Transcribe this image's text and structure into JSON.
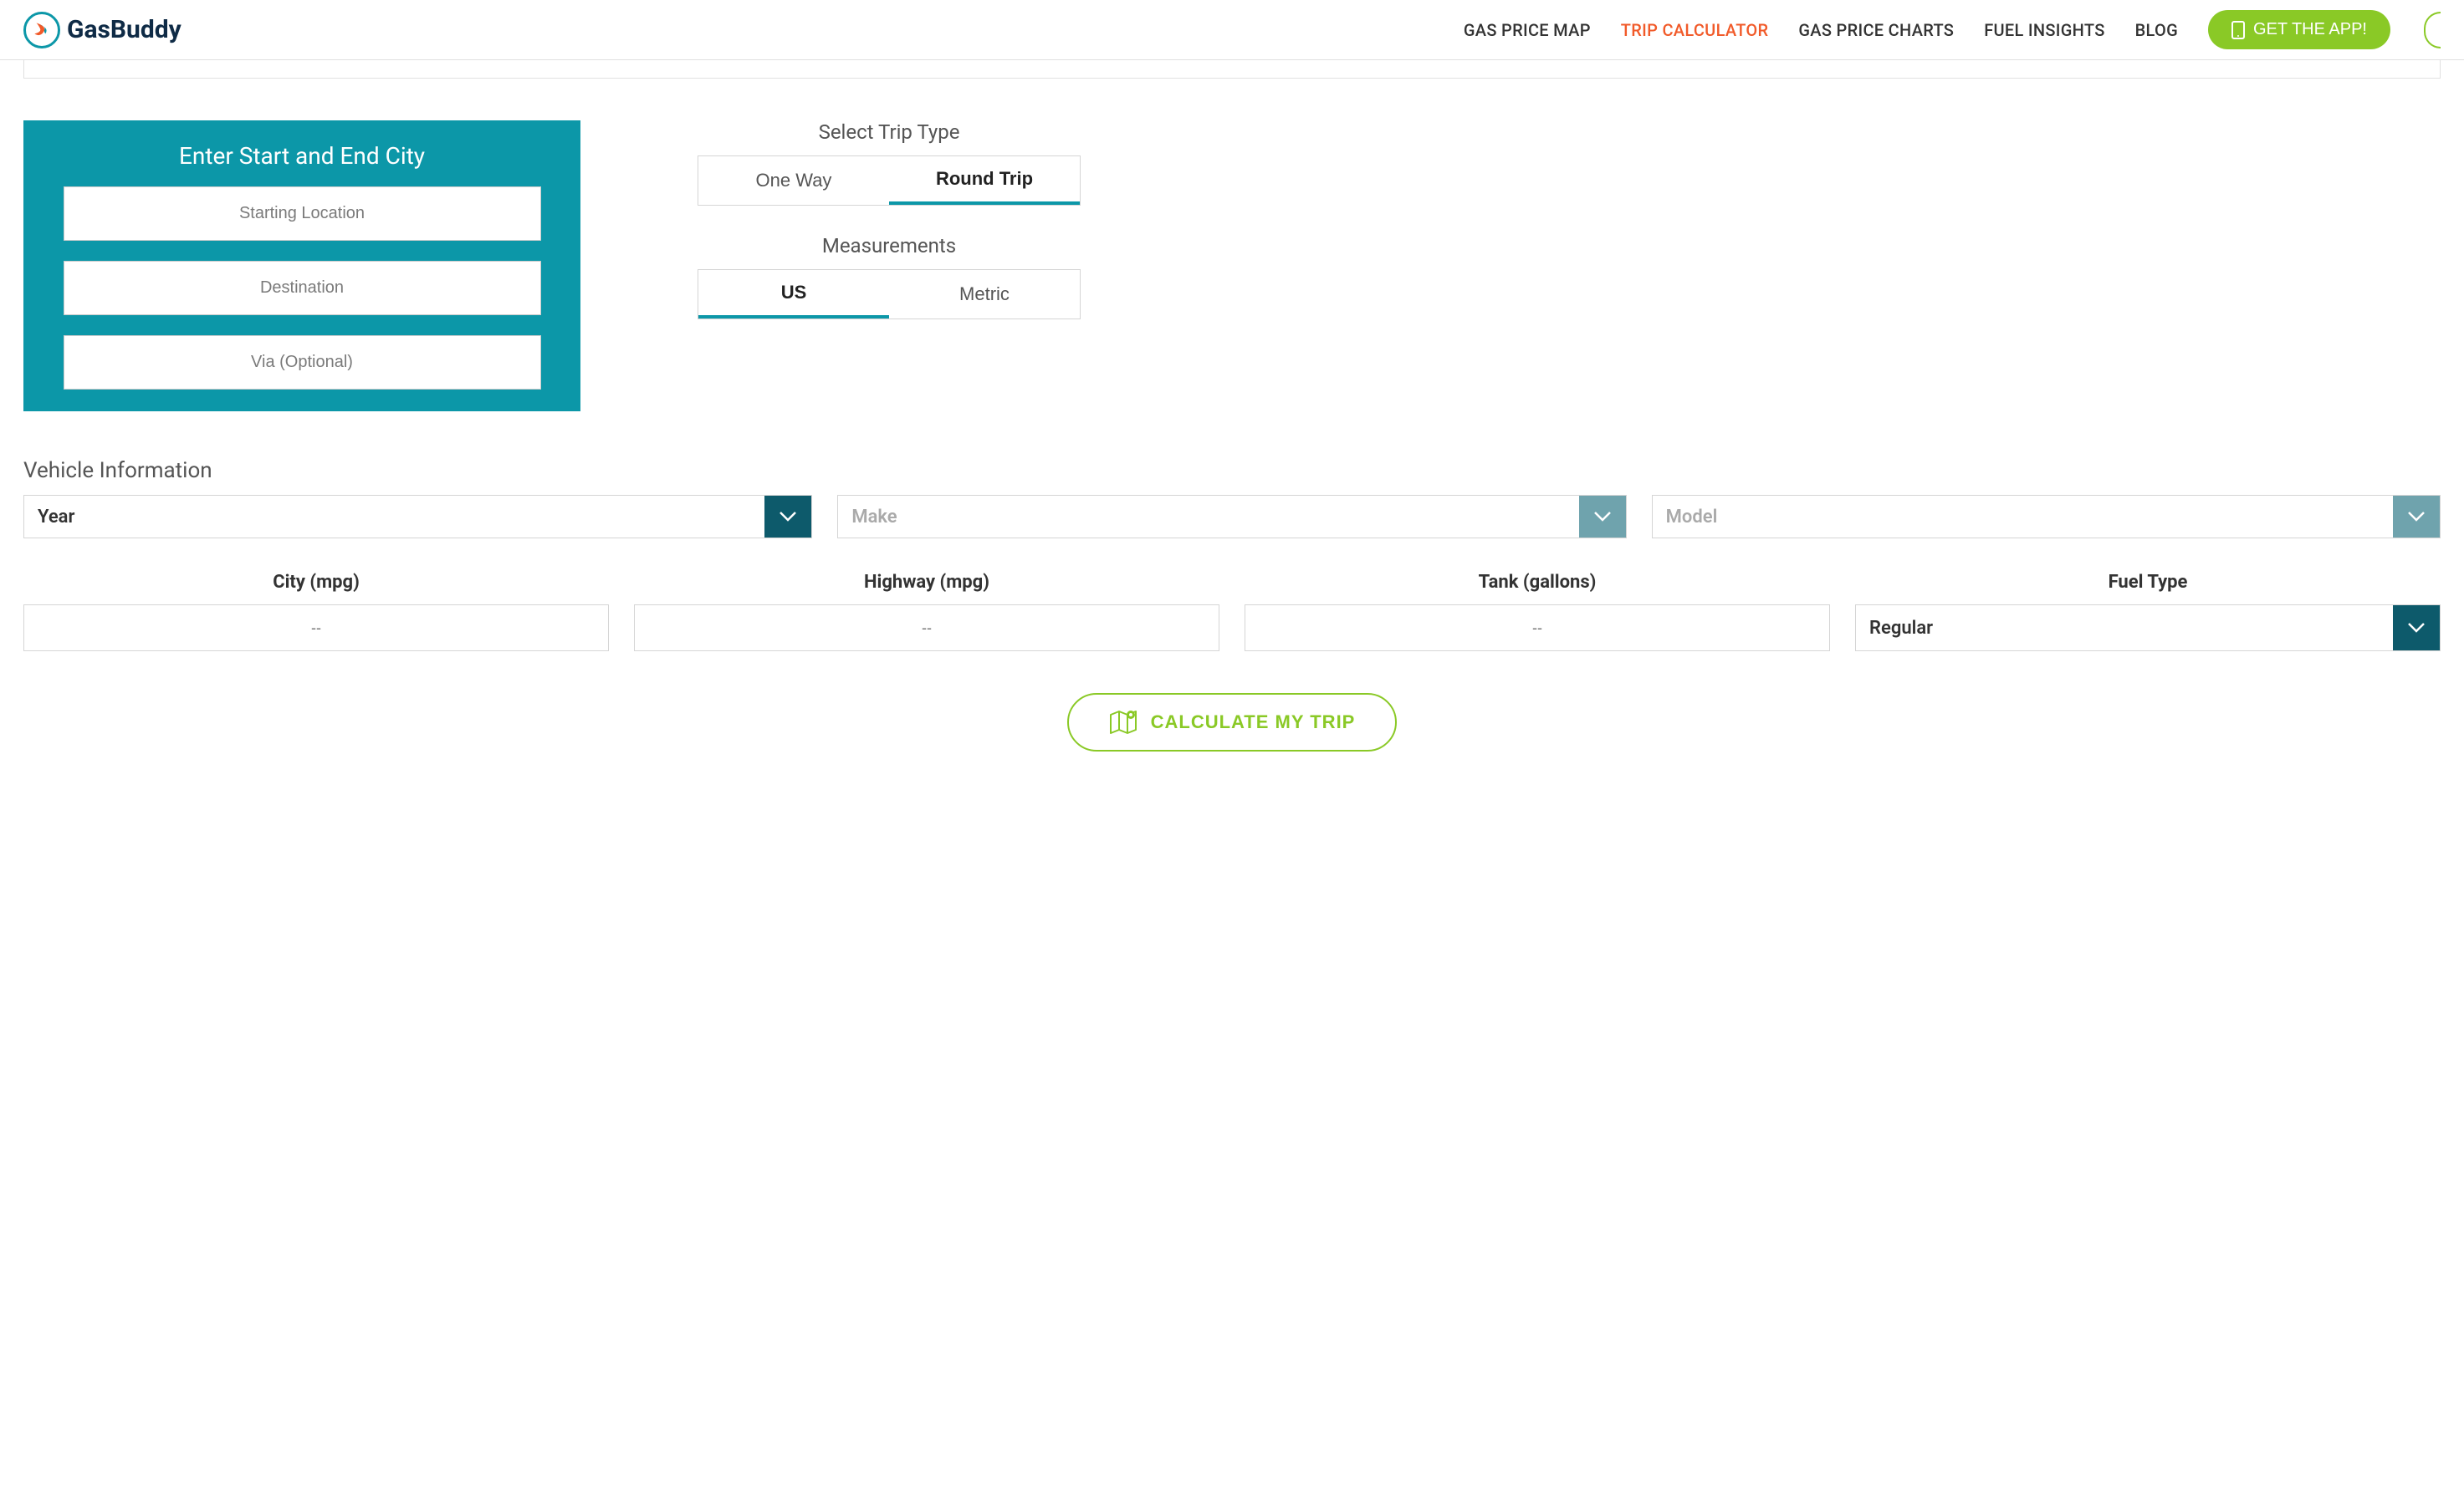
{
  "brand": "GasBuddy",
  "nav": {
    "items": [
      {
        "label": "GAS PRICE MAP",
        "active": false
      },
      {
        "label": "TRIP CALCULATOR",
        "active": true
      },
      {
        "label": "GAS PRICE CHARTS",
        "active": false
      },
      {
        "label": "FUEL INSIGHTS",
        "active": false
      },
      {
        "label": "BLOG",
        "active": false
      }
    ],
    "cta": "GET THE APP!"
  },
  "locationPanel": {
    "title": "Enter Start and End City",
    "start_placeholder": "Starting Location",
    "dest_placeholder": "Destination",
    "via_placeholder": "Via (Optional)"
  },
  "tripType": {
    "label": "Select Trip Type",
    "options": [
      "One Way",
      "Round Trip"
    ],
    "selected": "Round Trip"
  },
  "measurements": {
    "label": "Measurements",
    "options": [
      "US",
      "Metric"
    ],
    "selected": "US"
  },
  "vehicle": {
    "title": "Vehicle Information",
    "year": {
      "label": "Year",
      "enabled": true
    },
    "make": {
      "label": "Make",
      "enabled": false
    },
    "model": {
      "label": "Model",
      "enabled": false
    },
    "specs": {
      "city": {
        "label": "City (mpg)",
        "value": "--"
      },
      "highway": {
        "label": "Highway (mpg)",
        "value": "--"
      },
      "tank": {
        "label": "Tank (gallons)",
        "value": "--"
      },
      "fuel": {
        "label": "Fuel Type",
        "value": "Regular"
      }
    }
  },
  "calculate_label": "CALCULATE MY TRIP"
}
